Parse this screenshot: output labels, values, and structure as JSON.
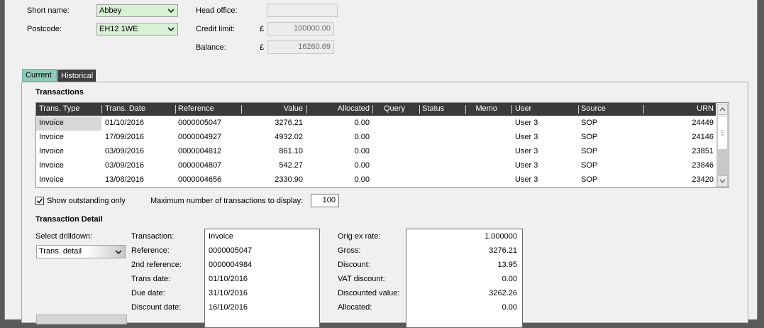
{
  "header": {
    "short_name_label": "Short name:",
    "short_name_value": "Abbey",
    "postcode_label": "Postcode:",
    "postcode_value": "EH12 1WE",
    "head_office_label": "Head office:",
    "head_office_value": "",
    "credit_limit_label": "Credit limit:",
    "credit_currency": "£",
    "credit_limit_value": "100000.00",
    "balance_label": "Balance:",
    "balance_currency": "£",
    "balance_value": "16260.69"
  },
  "tabs": [
    {
      "label": "Current",
      "active": true
    },
    {
      "label": "Historical",
      "active": false
    }
  ],
  "transactions": {
    "section_title": "Transactions",
    "columns": [
      "Trans. Type",
      "Trans. Date",
      "Reference",
      "Value",
      "Allocated",
      "Query",
      "Status",
      "Memo",
      "User",
      "Source",
      "URN"
    ],
    "rows": [
      {
        "type": "Invoice",
        "date": "01/10/2016",
        "reference": "0000005047",
        "value": "3276.21",
        "allocated": "0.00",
        "query": "",
        "status": "",
        "memo": "",
        "user": "User 3",
        "source": "SOP",
        "urn": "24449"
      },
      {
        "type": "Invoice",
        "date": "17/09/2016",
        "reference": "0000004927",
        "value": "4932.02",
        "allocated": "0.00",
        "query": "",
        "status": "",
        "memo": "",
        "user": "User 3",
        "source": "SOP",
        "urn": "24146"
      },
      {
        "type": "Invoice",
        "date": "03/09/2016",
        "reference": "0000004812",
        "value": "861.10",
        "allocated": "0.00",
        "query": "",
        "status": "",
        "memo": "",
        "user": "User 3",
        "source": "SOP",
        "urn": "23851"
      },
      {
        "type": "Invoice",
        "date": "03/09/2016",
        "reference": "0000004807",
        "value": "542.27",
        "allocated": "0.00",
        "query": "",
        "status": "",
        "memo": "",
        "user": "User 3",
        "source": "SOP",
        "urn": "23846"
      },
      {
        "type": "Invoice",
        "date": "13/08/2016",
        "reference": "0000004656",
        "value": "2330.90",
        "allocated": "0.00",
        "query": "",
        "status": "",
        "memo": "",
        "user": "User 3",
        "source": "SOP",
        "urn": "23420"
      }
    ],
    "show_outstanding_label": "Show outstanding only",
    "show_outstanding_checked": true,
    "max_label": "Maximum number of transactions to display:",
    "max_value": "100"
  },
  "detail": {
    "section_title": "Transaction Detail",
    "drilldown_label": "Select drilldown:",
    "drilldown_value": "Trans. detail",
    "left": [
      {
        "label": "Transaction:",
        "value": "Invoice"
      },
      {
        "label": "Reference:",
        "value": "0000005047"
      },
      {
        "label": "2nd reference:",
        "value": "0000004984"
      },
      {
        "label": "Trans date:",
        "value": "01/10/2016"
      },
      {
        "label": "Due date:",
        "value": "31/10/2016"
      },
      {
        "label": "Discount date:",
        "value": "16/10/2016"
      }
    ],
    "right": [
      {
        "label": "Orig ex rate:",
        "value": "1.000000"
      },
      {
        "label": "Gross:",
        "value": "3276.21"
      },
      {
        "label": "Discount:",
        "value": "13.95"
      },
      {
        "label": "VAT discount:",
        "value": "0.00"
      },
      {
        "label": "Discounted value:",
        "value": "3262.26"
      },
      {
        "label": "Allocated:",
        "value": "0.00"
      }
    ]
  }
}
